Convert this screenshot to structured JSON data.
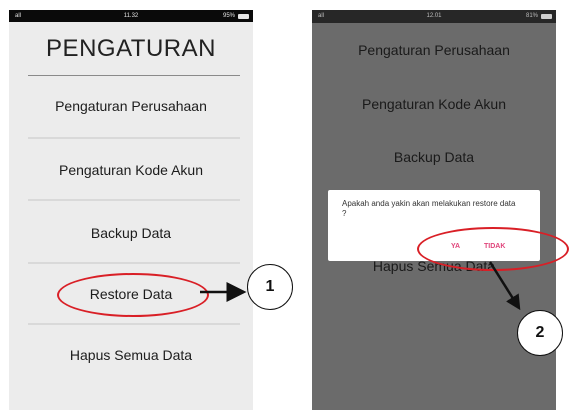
{
  "screen1": {
    "status": {
      "signal": "all",
      "time": "11.32",
      "battery": "95%"
    },
    "title": "PENGATURAN",
    "menu": [
      "Pengaturan Perusahaan",
      "Pengaturan Kode Akun",
      "Backup Data",
      "Restore Data",
      "Hapus Semua Data"
    ]
  },
  "screen2": {
    "status": {
      "signal": "all",
      "time": "12.01",
      "battery": "81%"
    },
    "menu": [
      "Pengaturan Perusahaan",
      "Pengaturan Kode Akun",
      "Backup Data",
      "Hapus Semua Data"
    ],
    "dialog": {
      "message": "Apakah anda yakin akan melakukan restore data ?",
      "yes_label": "YA",
      "no_label": "TIDAK"
    }
  },
  "annotations": {
    "step1": "1",
    "step2": "2",
    "highlight_color": "#d91f26"
  }
}
